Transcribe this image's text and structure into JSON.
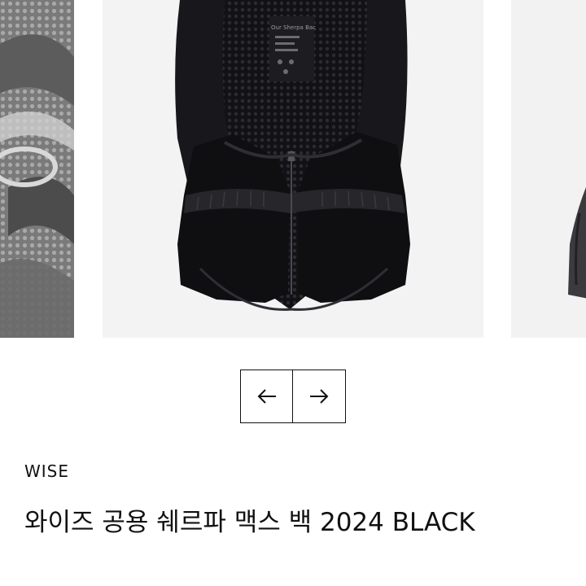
{
  "carousel": {
    "prev_arrow_icon": "arrow-left-icon",
    "next_arrow_icon": "arrow-right-icon",
    "label_text": "Our Sherpa Bac"
  },
  "product": {
    "brand": "WISE",
    "name": "와이즈 공용 쉐르파 맥스 백 2024 BLACK"
  },
  "colors": {
    "page_background": "#ffffff",
    "text": "#111111",
    "image_background": "#f3f3f3",
    "vest": "#111116"
  }
}
